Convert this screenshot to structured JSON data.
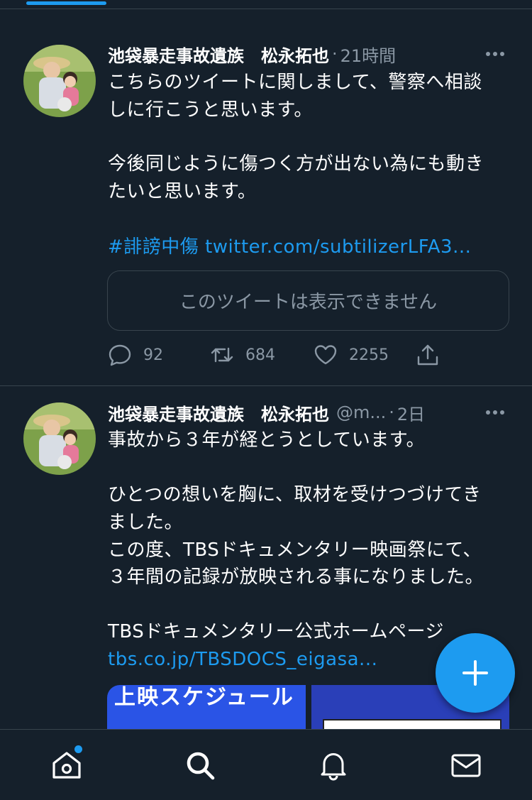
{
  "tweets": [
    {
      "author_name": "池袋暴走事故遺族　松永拓也",
      "handle": "",
      "separator": "·",
      "time": "21時間",
      "body_lines": [
        "こちらのツイートに関しまして、警察へ相談",
        "しに行こうと思います。",
        "今後同じように傷つく方が出ない為にも動き",
        "たいと思います。"
      ],
      "hashtag": "#誹謗中傷",
      "link_text": "twitter.com/subtilizerLFA3...",
      "quoted_placeholder": "このツイートは表示できません",
      "reply_count": "92",
      "retweet_count": "684",
      "like_count": "2255"
    },
    {
      "author_name": "池袋暴走事故遺族　松永拓也",
      "handle": "@m...",
      "separator": "·",
      "time": "2日",
      "body_lines": [
        "事故から３年が経とうとしています。",
        "ひとつの想いを胸に、取材を受けつづけてき",
        "ました。",
        "この度、TBSドキュメンタリー映画祭にて、",
        "３年間の記録が放映される事になりました。",
        "TBSドキュメンタリー公式ホームページ"
      ],
      "link_text": "tbs.co.jp/TBSDOCS_eigasa...",
      "media_left_title": "上映スケジュール"
    }
  ],
  "icons": {
    "more": "more-icon",
    "reply": "reply-icon",
    "retweet": "retweet-icon",
    "like": "heart-icon",
    "share": "share-icon",
    "compose": "plus-icon",
    "home": "home-icon",
    "search": "search-icon",
    "notifications": "bell-icon",
    "messages": "mail-icon"
  },
  "colors": {
    "background": "#15202b",
    "accent": "#1d9bf0",
    "secondary_text": "#8b98a5",
    "border": "#38444d"
  }
}
